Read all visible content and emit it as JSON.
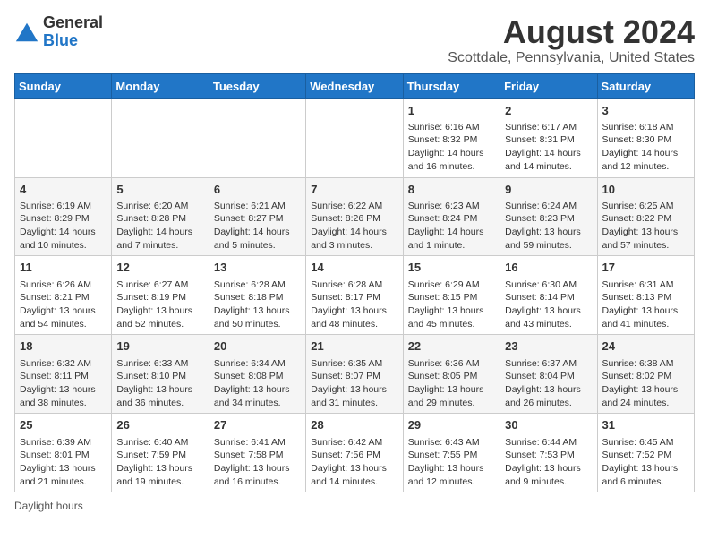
{
  "header": {
    "logo_general": "General",
    "logo_blue": "Blue",
    "title": "August 2024",
    "subtitle": "Scottdale, Pennsylvania, United States"
  },
  "days_of_week": [
    "Sunday",
    "Monday",
    "Tuesday",
    "Wednesday",
    "Thursday",
    "Friday",
    "Saturday"
  ],
  "weeks": [
    [
      {
        "day": "",
        "info": ""
      },
      {
        "day": "",
        "info": ""
      },
      {
        "day": "",
        "info": ""
      },
      {
        "day": "",
        "info": ""
      },
      {
        "day": "1",
        "info": "Sunrise: 6:16 AM\nSunset: 8:32 PM\nDaylight: 14 hours and 16 minutes."
      },
      {
        "day": "2",
        "info": "Sunrise: 6:17 AM\nSunset: 8:31 PM\nDaylight: 14 hours and 14 minutes."
      },
      {
        "day": "3",
        "info": "Sunrise: 6:18 AM\nSunset: 8:30 PM\nDaylight: 14 hours and 12 minutes."
      }
    ],
    [
      {
        "day": "4",
        "info": "Sunrise: 6:19 AM\nSunset: 8:29 PM\nDaylight: 14 hours and 10 minutes."
      },
      {
        "day": "5",
        "info": "Sunrise: 6:20 AM\nSunset: 8:28 PM\nDaylight: 14 hours and 7 minutes."
      },
      {
        "day": "6",
        "info": "Sunrise: 6:21 AM\nSunset: 8:27 PM\nDaylight: 14 hours and 5 minutes."
      },
      {
        "day": "7",
        "info": "Sunrise: 6:22 AM\nSunset: 8:26 PM\nDaylight: 14 hours and 3 minutes."
      },
      {
        "day": "8",
        "info": "Sunrise: 6:23 AM\nSunset: 8:24 PM\nDaylight: 14 hours and 1 minute."
      },
      {
        "day": "9",
        "info": "Sunrise: 6:24 AM\nSunset: 8:23 PM\nDaylight: 13 hours and 59 minutes."
      },
      {
        "day": "10",
        "info": "Sunrise: 6:25 AM\nSunset: 8:22 PM\nDaylight: 13 hours and 57 minutes."
      }
    ],
    [
      {
        "day": "11",
        "info": "Sunrise: 6:26 AM\nSunset: 8:21 PM\nDaylight: 13 hours and 54 minutes."
      },
      {
        "day": "12",
        "info": "Sunrise: 6:27 AM\nSunset: 8:19 PM\nDaylight: 13 hours and 52 minutes."
      },
      {
        "day": "13",
        "info": "Sunrise: 6:28 AM\nSunset: 8:18 PM\nDaylight: 13 hours and 50 minutes."
      },
      {
        "day": "14",
        "info": "Sunrise: 6:28 AM\nSunset: 8:17 PM\nDaylight: 13 hours and 48 minutes."
      },
      {
        "day": "15",
        "info": "Sunrise: 6:29 AM\nSunset: 8:15 PM\nDaylight: 13 hours and 45 minutes."
      },
      {
        "day": "16",
        "info": "Sunrise: 6:30 AM\nSunset: 8:14 PM\nDaylight: 13 hours and 43 minutes."
      },
      {
        "day": "17",
        "info": "Sunrise: 6:31 AM\nSunset: 8:13 PM\nDaylight: 13 hours and 41 minutes."
      }
    ],
    [
      {
        "day": "18",
        "info": "Sunrise: 6:32 AM\nSunset: 8:11 PM\nDaylight: 13 hours and 38 minutes."
      },
      {
        "day": "19",
        "info": "Sunrise: 6:33 AM\nSunset: 8:10 PM\nDaylight: 13 hours and 36 minutes."
      },
      {
        "day": "20",
        "info": "Sunrise: 6:34 AM\nSunset: 8:08 PM\nDaylight: 13 hours and 34 minutes."
      },
      {
        "day": "21",
        "info": "Sunrise: 6:35 AM\nSunset: 8:07 PM\nDaylight: 13 hours and 31 minutes."
      },
      {
        "day": "22",
        "info": "Sunrise: 6:36 AM\nSunset: 8:05 PM\nDaylight: 13 hours and 29 minutes."
      },
      {
        "day": "23",
        "info": "Sunrise: 6:37 AM\nSunset: 8:04 PM\nDaylight: 13 hours and 26 minutes."
      },
      {
        "day": "24",
        "info": "Sunrise: 6:38 AM\nSunset: 8:02 PM\nDaylight: 13 hours and 24 minutes."
      }
    ],
    [
      {
        "day": "25",
        "info": "Sunrise: 6:39 AM\nSunset: 8:01 PM\nDaylight: 13 hours and 21 minutes."
      },
      {
        "day": "26",
        "info": "Sunrise: 6:40 AM\nSunset: 7:59 PM\nDaylight: 13 hours and 19 minutes."
      },
      {
        "day": "27",
        "info": "Sunrise: 6:41 AM\nSunset: 7:58 PM\nDaylight: 13 hours and 16 minutes."
      },
      {
        "day": "28",
        "info": "Sunrise: 6:42 AM\nSunset: 7:56 PM\nDaylight: 13 hours and 14 minutes."
      },
      {
        "day": "29",
        "info": "Sunrise: 6:43 AM\nSunset: 7:55 PM\nDaylight: 13 hours and 12 minutes."
      },
      {
        "day": "30",
        "info": "Sunrise: 6:44 AM\nSunset: 7:53 PM\nDaylight: 13 hours and 9 minutes."
      },
      {
        "day": "31",
        "info": "Sunrise: 6:45 AM\nSunset: 7:52 PM\nDaylight: 13 hours and 6 minutes."
      }
    ]
  ],
  "footer": {
    "note": "Daylight hours"
  }
}
